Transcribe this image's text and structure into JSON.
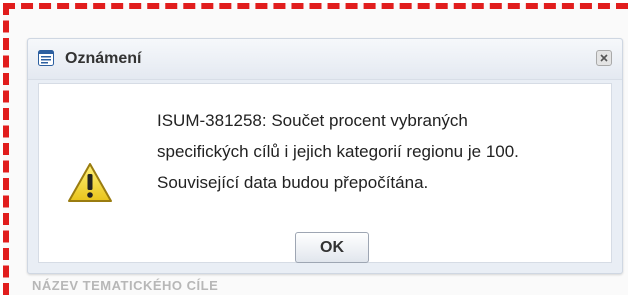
{
  "dialog": {
    "title": "Oznámení",
    "title_icon": "message-window-icon",
    "close_icon": "close-icon",
    "message_icon": "warning-icon",
    "message_lines": [
      "ISUM-381258: Součet procent vybraných",
      "specifických cílů i jejich kategorií regionu je 100.",
      "Související data budou přepočítána."
    ],
    "ok_label": "OK"
  },
  "background": {
    "column_header": "NÁZEV TEMATICKÉHO CÍLE"
  },
  "colors": {
    "highlight_border": "#e11d1d",
    "warning_yellow": "#f2d22c"
  }
}
